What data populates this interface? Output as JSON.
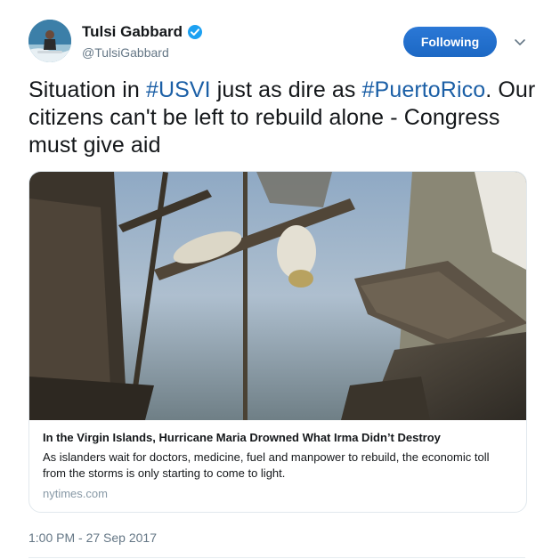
{
  "author": {
    "display_name": "Tulsi Gabbard",
    "handle": "@TulsiGabbard",
    "verified_icon": "verified-badge-icon"
  },
  "actions": {
    "follow_label": "Following",
    "more_icon": "chevron-down-icon"
  },
  "tweet": {
    "text_1": "Situation in ",
    "hashtag_1": "#USVI",
    "text_2": " just as dire as ",
    "hashtag_2": "#PuertoRico",
    "text_3": ". Our citizens can't be left to rebuild alone - Congress must give aid"
  },
  "card": {
    "title": "In the Virgin Islands, Hurricane Maria Drowned What Irma Didn’t Destroy",
    "description": "As islanders wait for doctors, medicine, fuel and manpower to rebuild, the economic toll from the storms is only starting to come to light.",
    "domain": "nytimes.com"
  },
  "timestamp": "1:00 PM - 27 Sep 2017",
  "colors": {
    "link": "#1b5fa6",
    "button": "#1d6fd0",
    "secondary_text": "#657786",
    "verified": "#1da1f2"
  }
}
